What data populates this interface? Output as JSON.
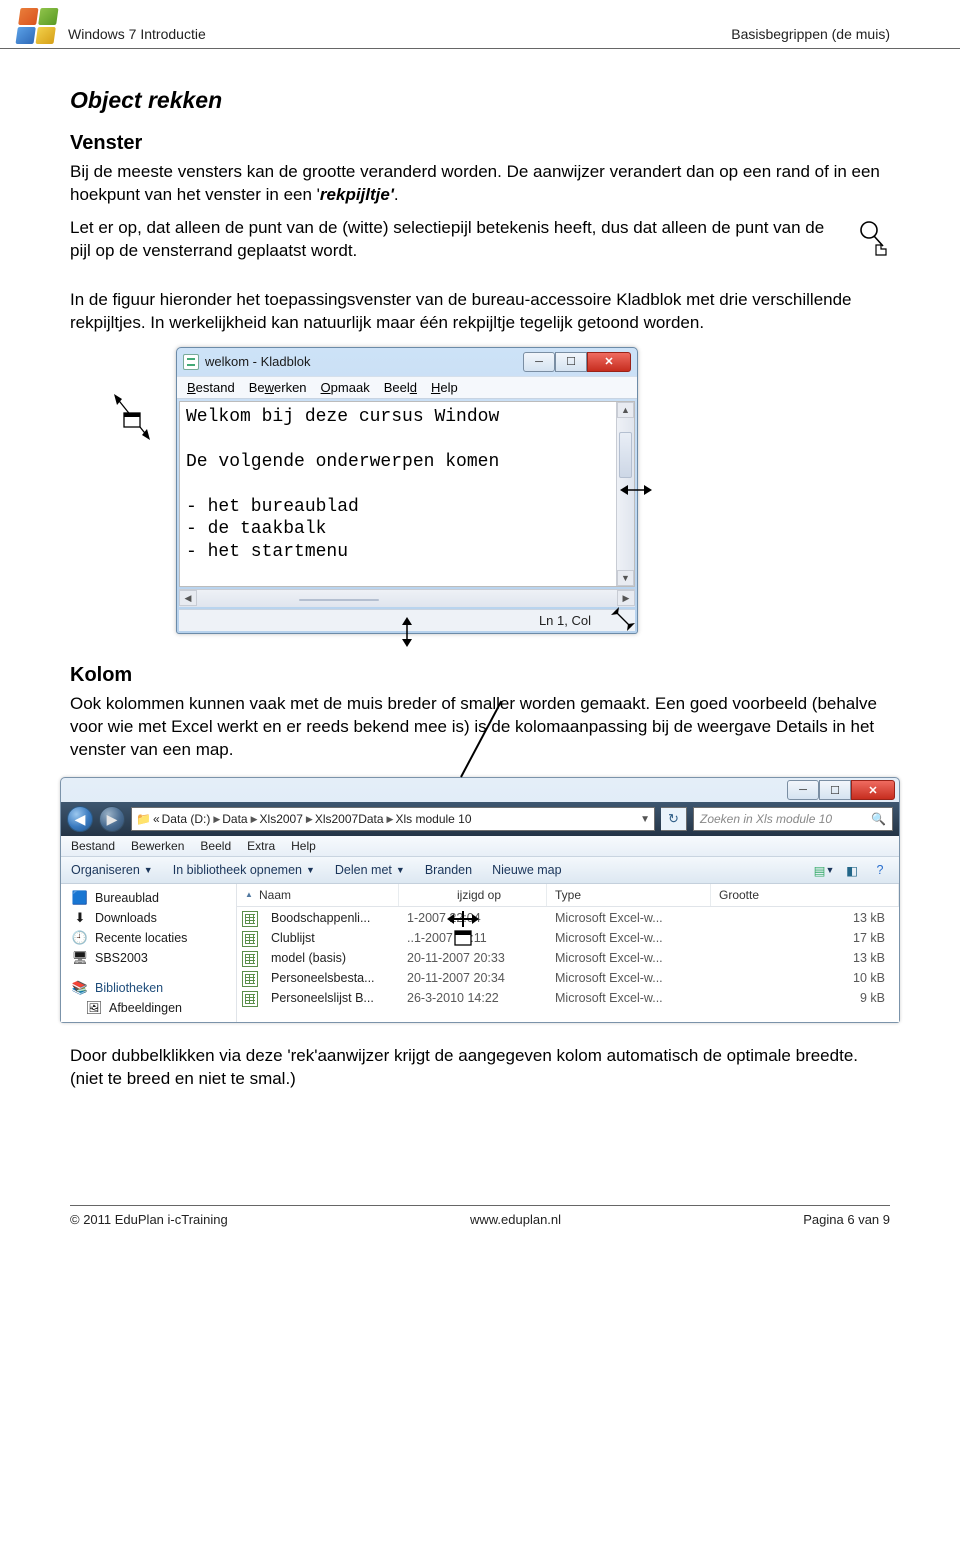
{
  "header": {
    "left": "Windows 7 Introductie",
    "right": "Basisbegrippen (de muis)"
  },
  "section1": {
    "title": "Object rekken",
    "subtitle": "Venster",
    "p1a": "Bij de meeste vensters kan de grootte veranderd worden. De aanwijzer verandert dan op een rand of in een hoekpunt van het venster in een '",
    "p1b": "rekpijltje'",
    "p1c": ".",
    "p2": "Let er op, dat alleen de punt van de (witte) selectiepijl betekenis heeft, dus dat alleen de punt van de pijl op de vensterrand geplaatst wordt.",
    "p3": "In de figuur hieronder het toepassingsvenster van de bureau-accessoire Kladblok met drie verschillende rekpijltjes. In werkelijkheid kan natuurlijk maar één rekpijltje tegelijk getoond worden."
  },
  "notepad": {
    "title": "welkom - Kladblok",
    "menu": [
      "Bestand",
      "Bewerken",
      "Opmaak",
      "Beeld",
      "Help"
    ],
    "content": "Welkom bij deze cursus Window\n\nDe volgende onderwerpen komen\n\n- het bureaublad\n- de taakbalk\n- het startmenu",
    "status": "Ln 1, Col"
  },
  "section2": {
    "title": "Kolom",
    "p1": "Ook kolommen kunnen vaak met de muis breder of smaller worden gemaakt. Een goed voorbeeld (behalve voor wie met Excel werkt en er reeds bekend mee is) is de kolomaanpassing bij de weergave Details in het venster van een map.",
    "p2": "Door dubbelklikken via deze 'rek'aanwijzer krijgt de aangegeven kolom automatisch de optimale breedte. (niet te breed en niet te smal.)"
  },
  "explorer": {
    "breadcrumb": [
      "Data (D:)",
      "Data",
      "Xls2007",
      "Xls2007Data",
      "Xls module 10"
    ],
    "search_placeholder": "Zoeken in Xls module 10",
    "menu": [
      "Bestand",
      "Bewerken",
      "Beeld",
      "Extra",
      "Help"
    ],
    "toolbar": {
      "organiseren": "Organiseren",
      "bibliotheek": "In bibliotheek opnemen",
      "delen": "Delen met",
      "branden": "Branden",
      "nieuwe_map": "Nieuwe map"
    },
    "sidebar": {
      "items": [
        "Bureaublad",
        "Downloads",
        "Recente locaties",
        "SBS2003"
      ],
      "lib_header": "Bibliotheken",
      "lib_items": [
        "Afbeeldingen"
      ]
    },
    "columns": {
      "naam": "Naam",
      "gewijzigd": "ijzigd op",
      "type": "Type",
      "grootte": "Grootte"
    },
    "files": [
      {
        "name": "Boodschappenli...",
        "date": "1-2007 22:04",
        "type": "Microsoft Excel-w...",
        "size": "13 kB"
      },
      {
        "name": "Clublijst",
        "date": "..1-2007 21:11",
        "type": "Microsoft Excel-w...",
        "size": "17 kB"
      },
      {
        "name": "model (basis)",
        "date": "20-11-2007 20:33",
        "type": "Microsoft Excel-w...",
        "size": "13 kB"
      },
      {
        "name": "Personeelsbesta...",
        "date": "20-11-2007 20:34",
        "type": "Microsoft Excel-w...",
        "size": "10 kB"
      },
      {
        "name": "Personeelslijst B...",
        "date": "26-3-2010 14:22",
        "type": "Microsoft Excel-w...",
        "size": "9 kB"
      }
    ]
  },
  "footer": {
    "left": "© 2011 EduPlan i-cTraining",
    "mid": "www.eduplan.nl",
    "right": "Pagina 6 van 9"
  }
}
